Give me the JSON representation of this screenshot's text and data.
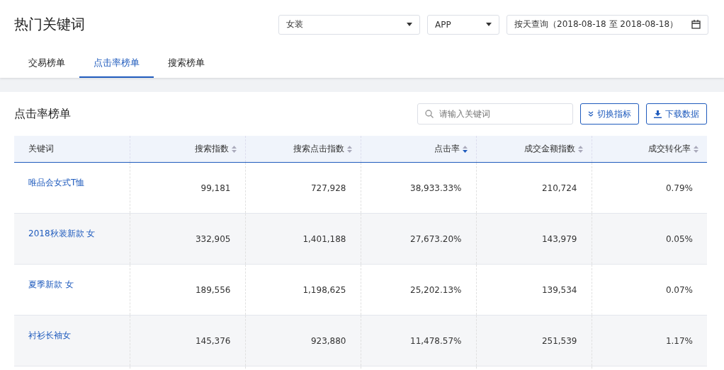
{
  "page": {
    "title": "热门关键词"
  },
  "filters": {
    "category": "女装",
    "platform": "APP",
    "date_range": "按天查询（2018-08-18 至 2018-08-18）"
  },
  "tabs": [
    {
      "label": "交易榜单",
      "selected": false
    },
    {
      "label": "点击率榜单",
      "selected": true
    },
    {
      "label": "搜索榜单",
      "selected": false
    }
  ],
  "panel": {
    "title": "点击率榜单",
    "search": {
      "placeholder": "请输入关键词"
    },
    "buttons": [
      {
        "kind": "switch",
        "label": "切换指标"
      },
      {
        "kind": "download",
        "label": "下载数据"
      }
    ]
  },
  "table": {
    "columns": [
      {
        "label": "关键词"
      },
      {
        "label": "搜索指数",
        "sorted": false
      },
      {
        "label": "搜索点击指数",
        "sorted": false
      },
      {
        "label": "点击率",
        "sorted": true
      },
      {
        "label": "成交金额指数",
        "sorted": false
      },
      {
        "label": "成交转化率",
        "sorted": false
      }
    ],
    "rows": [
      [
        "唯品会女式T恤",
        "99,181",
        "727,928",
        "38,933.33%",
        "210,724",
        "0.79%"
      ],
      [
        "2018秋装新款 女",
        "332,905",
        "1,401,188",
        "27,673.20%",
        "143,979",
        "0.05%"
      ],
      [
        "夏季新款 女",
        "189,556",
        "1,198,625",
        "25,202.13%",
        "139,534",
        "0.07%"
      ],
      [
        "衬衫长袖女",
        "145,376",
        "923,880",
        "11,478.57%",
        "251,539",
        "1.17%"
      ]
    ]
  }
}
